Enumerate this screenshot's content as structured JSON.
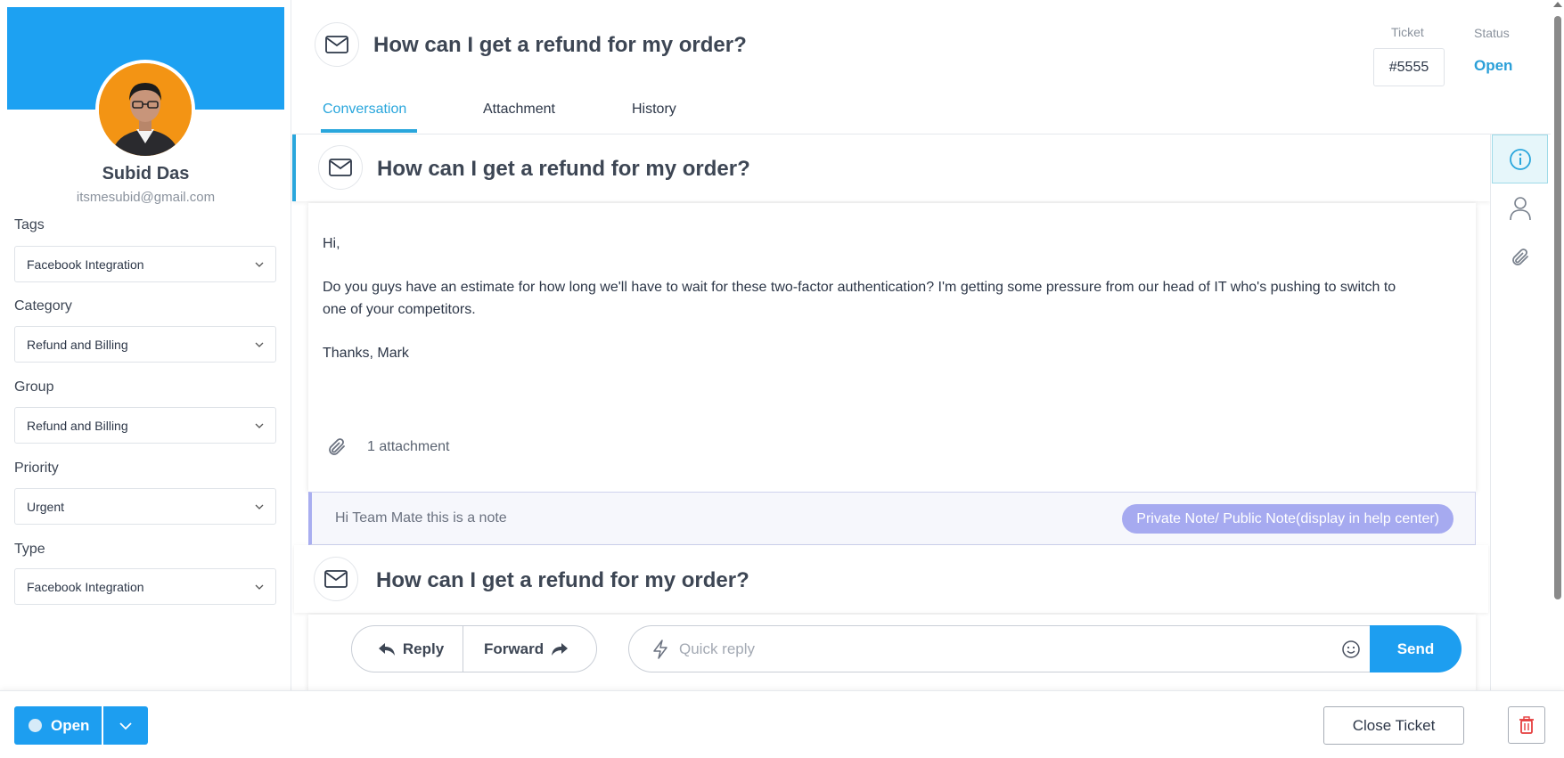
{
  "profile": {
    "name": "Subid Das",
    "email": "itsmesubid@gmail.com",
    "cover_color": "#1da1f2",
    "avatar_bg": "#f39414"
  },
  "fields": [
    {
      "label": "Tags",
      "value": "Facebook Integration"
    },
    {
      "label": "Category",
      "value": "Refund and Billing"
    },
    {
      "label": "Group",
      "value": "Refund and Billing"
    },
    {
      "label": "Priority",
      "value": "Urgent"
    },
    {
      "label": "Type",
      "value": "Facebook Integration"
    }
  ],
  "header": {
    "title": "How can I get a refund for my order?",
    "ticket_label": "Ticket",
    "ticket_value": "#5555",
    "status_label": "Status",
    "status_value": "Open",
    "tabs": [
      {
        "label": "Conversation",
        "active": true
      },
      {
        "label": "Attachment",
        "active": false
      },
      {
        "label": "History",
        "active": false
      }
    ]
  },
  "message": {
    "subject": "How can I get a refund for my order?",
    "greeting": "Hi,",
    "body_line1": "Do you guys have an estimate for how long we'll have to wait for these two-factor authentication? I'm getting some pressure from our head of IT who's pushing to switch to",
    "body_line2": "one of your competitors.",
    "signoff": "Thanks, Mark",
    "attachments": "1 attachment"
  },
  "note": {
    "text": "Hi Team Mate this is a note",
    "pill": "Private Note/ Public Note(display in help center)"
  },
  "message2": {
    "subject": "How can I get a refund for my order?"
  },
  "composer": {
    "reply_label": "Reply",
    "forward_label": "Forward",
    "quick_reply_placeholder": "Quick reply",
    "send_label": "Send"
  },
  "rail": {
    "items": [
      "info-icon",
      "user-icon",
      "paperclip-icon"
    ],
    "active": "info-icon"
  },
  "footer": {
    "status_button": "Open",
    "close_ticket": "Close Ticket"
  },
  "colors": {
    "accent": "#29a6dc",
    "primary_button": "#1d9ef0",
    "note_pill": "#a6aaf0",
    "delete": "#e53e3e"
  }
}
